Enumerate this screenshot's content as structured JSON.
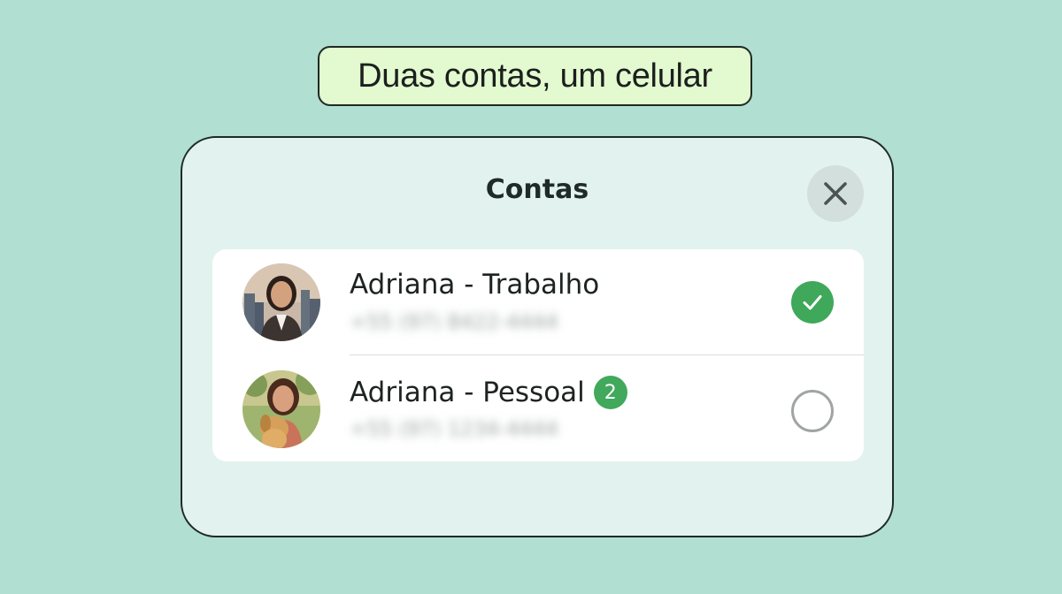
{
  "banner": {
    "text": "Duas contas, um celular"
  },
  "dialog": {
    "title": "Contas",
    "close_icon": "close-icon"
  },
  "accounts": [
    {
      "name": "Adriana - Trabalho",
      "phone": "+55 (97) 8422-4444",
      "selected": true,
      "badge": null,
      "avatar": "avatar-woman-business"
    },
    {
      "name": "Adriana - Pessoal",
      "phone": "+55 (97) 1234-4444",
      "selected": false,
      "badge": "2",
      "avatar": "avatar-woman-with-dog"
    }
  ],
  "colors": {
    "background": "#b1dfd1",
    "banner_bg": "#e3f9cf",
    "panel_bg": "#e2f3ef",
    "accent_green": "#3fa85a"
  }
}
